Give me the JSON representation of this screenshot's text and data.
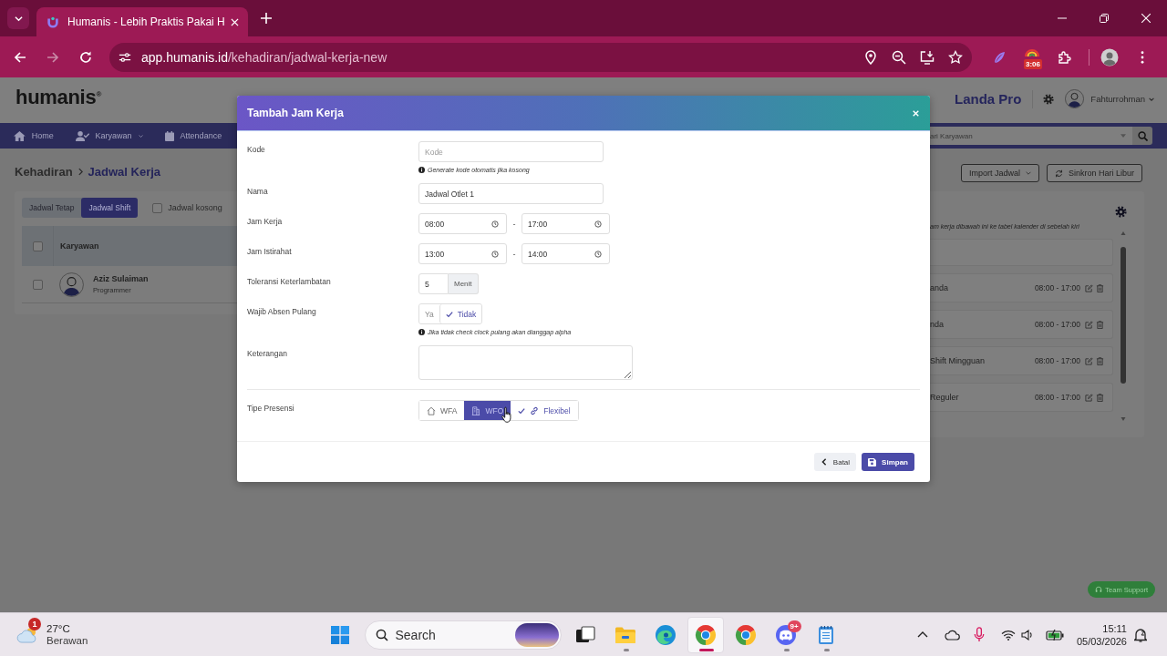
{
  "browser": {
    "tab_title": "Humanis - Lebih Praktis Pakai H",
    "nav_buttons": [
      {
        "kind": "back",
        "disabled": false
      },
      {
        "kind": "forward",
        "disabled": true
      },
      {
        "kind": "reload",
        "disabled": false
      }
    ],
    "url_host": "app.humanis.id",
    "url_path": "/kehadiran/jadwal-kerja-new",
    "extension_badge": "3:06"
  },
  "page": {
    "logo": "humanis$^{®}$",
    "company": "Landa Pro",
    "user": "Fahturrohman",
    "nav": [
      {
        "label": "Home",
        "dropdown": false
      },
      {
        "label": "Karyawan",
        "dropdown": true
      },
      {
        "label": "Attendance",
        "dropdown": false
      }
    ],
    "search": {
      "placeholder": "ari Karyawan"
    },
    "breadcrumb": [
      "Kehadiran",
      "Jadwal Kerja"
    ],
    "actions": [
      {
        "label": "Import Jadwal",
        "kind": "dropdown"
      },
      {
        "label": "Sinkron Hari Libur",
        "kind": "sync"
      }
    ],
    "view_tabs": [
      {
        "label": "Jadwal Tetap",
        "selected": false
      },
      {
        "label": "Jadwal Shift",
        "selected": true
      }
    ],
    "empty_filter": {
      "label": "Jadwal kosong",
      "checked": false
    },
    "table": {
      "columns": [
        "Karyawan"
      ],
      "all_checked": false,
      "rows": [
        {
          "name": "Aziz Sulaiman",
          "role": "Programmer",
          "checked": false
        }
      ]
    },
    "schedule_panel": {
      "hint": "am kerja dibawah ini ke tabel kalender di sebelah kiri",
      "items": [
        {
          "name": "anda",
          "time": "08:00 - 17:00"
        },
        {
          "name": "nda",
          "time": "08:00 - 17:00"
        },
        {
          "name": "Shift Mingguan",
          "time": "08:00 - 17:00"
        },
        {
          "name": "Reguler",
          "time": "08:00 - 17:00"
        }
      ]
    },
    "support_button": "Team Support"
  },
  "modal": {
    "title": "Tambah Jam Kerja",
    "fields": [
      {
        "kind": "text",
        "label": "Kode",
        "placeholder": "Kode",
        "help": "Generate kode otomatis jika kosong"
      },
      {
        "kind": "text",
        "label": "Nama",
        "value": "Jadwal Otlet 1"
      },
      {
        "kind": "time_range",
        "label": "Jam Kerja",
        "from": "08:00",
        "separator": "-",
        "to": "17:00"
      },
      {
        "kind": "time_range",
        "label": "Jam Istirahat",
        "from": "13:00",
        "separator": "-",
        "to": "14:00"
      },
      {
        "kind": "addon",
        "label": "Toleransi Keterlambatan",
        "value": "5",
        "addon": "Menit"
      },
      {
        "kind": "toggle",
        "label": "Wajib Absen Pulang",
        "options": [
          {
            "label": "Ya",
            "selected": false
          },
          {
            "label": "Tidak",
            "selected": true
          }
        ],
        "help": "Jika tidak check clock pulang akan dianggap alpha"
      },
      {
        "kind": "textarea",
        "label": "Keterangan"
      },
      {
        "kind": "segmented",
        "label": "Tipe Presensi",
        "options": [
          {
            "label": "WFA",
            "selected": false,
            "hovered": false
          },
          {
            "label": "WFO",
            "selected": false,
            "hovered": true
          },
          {
            "label": "Flexibel",
            "selected": true,
            "hovered": false
          }
        ]
      }
    ],
    "buttons": [
      {
        "label": "Batal",
        "kind": "secondary"
      },
      {
        "label": "Simpan",
        "kind": "primary"
      }
    ]
  },
  "taskbar": {
    "weather": {
      "alerts": "1",
      "temperature": "27°C",
      "condition": "Berawan"
    },
    "search_placeholder": "Search",
    "apps": [
      {
        "kind": "tasks",
        "running": false,
        "active": false
      },
      {
        "kind": "folder",
        "running": true,
        "active": false
      },
      {
        "kind": "edge",
        "running": false,
        "active": false
      },
      {
        "kind": "chrome",
        "running": true,
        "active": true
      },
      {
        "kind": "chrome",
        "running": false,
        "active": false
      },
      {
        "kind": "chat",
        "running": true,
        "active": false,
        "badge": "9+"
      },
      {
        "kind": "notepad",
        "running": true,
        "active": false
      }
    ],
    "time": "15:11",
    "date": "05/03/2026"
  }
}
